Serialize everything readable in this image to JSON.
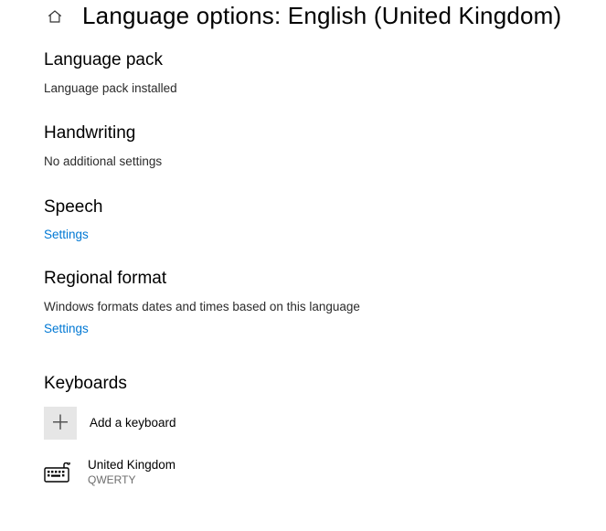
{
  "header": {
    "title": "Language options: English (United Kingdom)"
  },
  "sections": {
    "language_pack": {
      "heading": "Language pack",
      "body": "Language pack installed"
    },
    "handwriting": {
      "heading": "Handwriting",
      "body": "No additional settings"
    },
    "speech": {
      "heading": "Speech",
      "link": "Settings"
    },
    "regional": {
      "heading": "Regional format",
      "body": "Windows formats dates and times based on this language",
      "link": "Settings"
    },
    "keyboards": {
      "heading": "Keyboards",
      "add_label": "Add a keyboard",
      "items": [
        {
          "name": "United Kingdom",
          "layout": "QWERTY"
        }
      ]
    }
  }
}
